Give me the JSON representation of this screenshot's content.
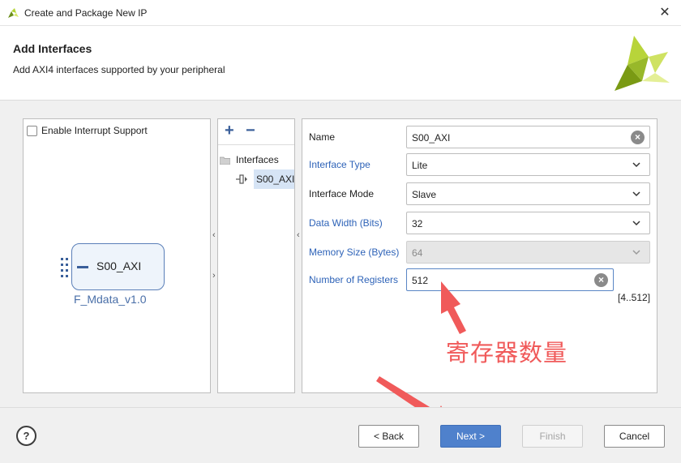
{
  "window": {
    "title": "Create and Package New IP"
  },
  "header": {
    "title": "Add Interfaces",
    "subtitle": "Add AXI4 interfaces supported by your peripheral"
  },
  "left_panel": {
    "interrupt_label": "Enable Interrupt Support",
    "interrupt_checked": false,
    "ip_port_label": "S00_AXI",
    "ip_name": "F_Mdata_v1.0"
  },
  "mid_panel": {
    "tree_root": "Interfaces",
    "tree_item": "S00_AXI"
  },
  "form": {
    "name": {
      "label": "Name",
      "value": "S00_AXI"
    },
    "interface_type": {
      "label": "Interface Type",
      "value": "Lite"
    },
    "interface_mode": {
      "label": "Interface Mode",
      "value": "Slave"
    },
    "data_width": {
      "label": "Data Width (Bits)",
      "value": "32"
    },
    "memory_size": {
      "label": "Memory Size (Bytes)",
      "value": "64"
    },
    "num_registers": {
      "label": "Number of Registers",
      "value": "512",
      "range": "[4..512]"
    }
  },
  "annotation": {
    "text": "寄存器数量",
    "color": "#f05a5a"
  },
  "footer": {
    "help": "?",
    "back": "< Back",
    "next": "Next >",
    "finish": "Finish",
    "cancel": "Cancel"
  },
  "colors": {
    "accent": "#4f81cc",
    "link": "#2e63b8",
    "brand": "#9bbf2a"
  },
  "icons": [
    "app-logo-icon",
    "close-icon",
    "brand-logo-icon",
    "add-icon",
    "remove-icon",
    "folder-icon",
    "interface-icon",
    "clear-icon",
    "chevron-down-icon",
    "help-icon"
  ]
}
